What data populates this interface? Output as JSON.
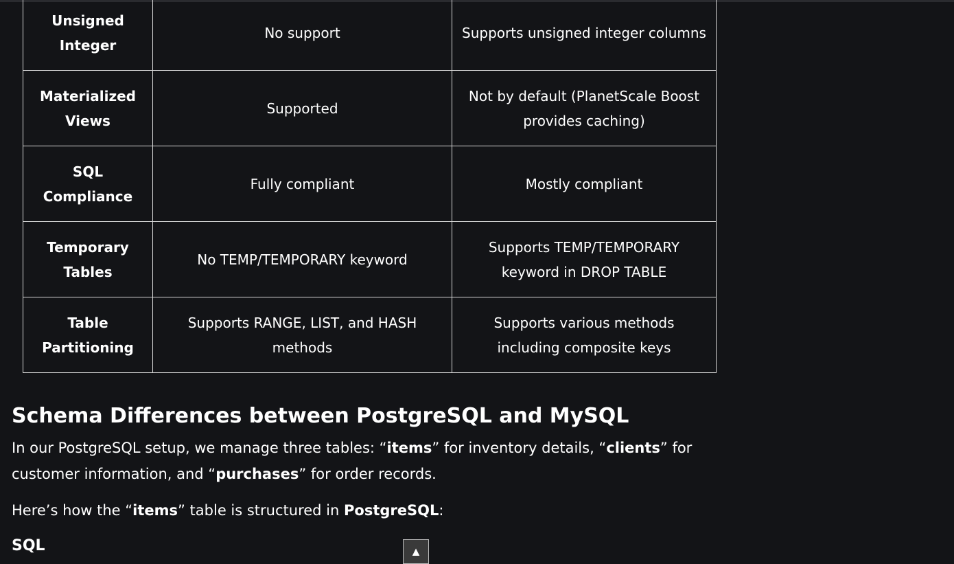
{
  "table": {
    "rows": [
      {
        "feature": "Unsigned Integer",
        "postgresql": "No support",
        "mysql": "Supports unsigned integer columns"
      },
      {
        "feature": "Materialized Views",
        "postgresql": "Supported",
        "mysql": "Not by default (PlanetScale Boost provides caching)"
      },
      {
        "feature": "SQL Compliance",
        "postgresql": "Fully compliant",
        "mysql": "Mostly compliant"
      },
      {
        "feature": "Temporary Tables",
        "postgresql": "No TEMP/TEMPORARY keyword",
        "mysql": "Supports TEMP/TEMPORARY keyword in DROP TABLE"
      },
      {
        "feature": "Table Partitioning",
        "postgresql": "Supports RANGE, LIST, and HASH methods",
        "mysql": "Supports various methods including composite keys"
      }
    ]
  },
  "section": {
    "title": "Schema Differences between PostgreSQL and MySQL"
  },
  "paragraph1": {
    "t1": "In our PostgreSQL setup, we manage three tables: “",
    "b1": "items",
    "t2": "” for inventory details, “",
    "b2": "clients",
    "t3": "” for customer information, and “",
    "b3": "purchases",
    "t4": "” for order records."
  },
  "paragraph2": {
    "t1": "Here’s how the “",
    "b1": "items",
    "t2": "” table is structured in ",
    "b2": "PostgreSQL",
    "t3": ":"
  },
  "code_block": {
    "language_label": "SQL"
  },
  "scroll_top_button": {
    "icon": "up-arrow-icon",
    "glyph": "▲"
  },
  "colors": {
    "background": "#131417",
    "text": "#ffffff",
    "table_border": "#d9d9d9",
    "button_bg": "#3a3a3a"
  }
}
